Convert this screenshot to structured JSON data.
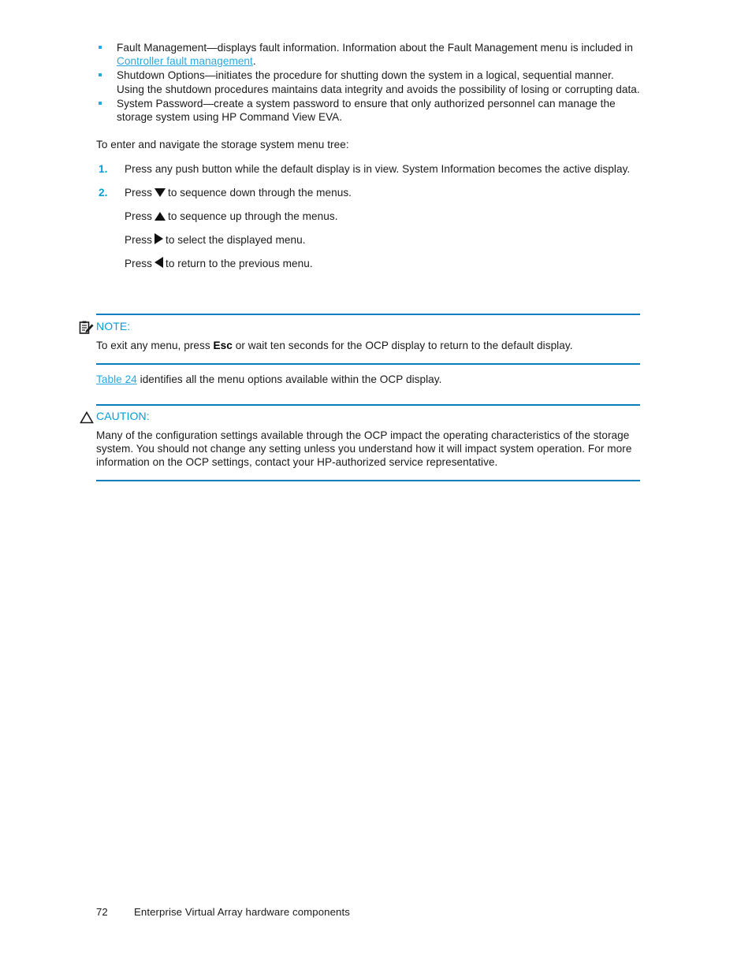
{
  "page": {
    "background_color": "#ffffff",
    "accent_color": "#29A8DF",
    "heading_color": "#009FDA",
    "rule_color": "#0A7CC0",
    "text_color": "#1a1a1a"
  },
  "bullets": [
    {
      "text_before_link": "Fault Management—displays fault information.  Information about the Fault Management menu is included in ",
      "link": "Controller fault management",
      "text_after_link": "."
    },
    {
      "text_before_link": "Shutdown Options—initiates the procedure for shutting down the system in a logical, sequential manner.  Using the shutdown procedures maintains data integrity and avoids the possibility of losing or corrupting data.",
      "link": "",
      "text_after_link": ""
    },
    {
      "text_before_link": "System Password—create a system password to ensure that only authorized personnel can manage the storage system using HP Command View EVA.",
      "link": "",
      "text_after_link": ""
    }
  ],
  "intro": "To enter and navigate the storage system menu tree:",
  "steps": [
    {
      "number": "1.",
      "text": "Press any push button while the default display is in view.  System Information becomes the active display."
    },
    {
      "number": "2.",
      "text_before_arrow": "Press",
      "arrow": "arrow-down-icon",
      "text_after_arrow": "to sequence down through the menus."
    }
  ],
  "substeps": [
    {
      "text_before_arrow": "Press",
      "arrow": "arrow-up-icon",
      "text_after_arrow": "to sequence up through the menus."
    },
    {
      "text_before_arrow": "Press",
      "arrow": "arrow-right-icon",
      "text_after_arrow": "to select the displayed menu."
    },
    {
      "text_before_arrow": "Press",
      "arrow": "arrow-left-icon",
      "text_after_arrow": "to return to the previous menu."
    }
  ],
  "note": {
    "icon": "note-clipboard-icon",
    "title": "NOTE:",
    "body_before_bold": "To exit any menu, press ",
    "body_bold": "Esc",
    "body_after_bold": " or wait ten seconds for the OCP display to return to the default display."
  },
  "table_reference": {
    "link": "Table 24",
    "text": " identifies all the menu options available within the OCP display."
  },
  "caution": {
    "icon": "caution-triangle-icon",
    "title": "CAUTION:",
    "body": "Many of the configuration settings available through the OCP impact the operating characteristics of the storage system.  You should not change any setting unless you understand how it will impact system operation.  For more information on the OCP settings, contact your HP-authorized service representative."
  },
  "footer": {
    "page_number": "72",
    "title": "Enterprise Virtual Array hardware components"
  }
}
